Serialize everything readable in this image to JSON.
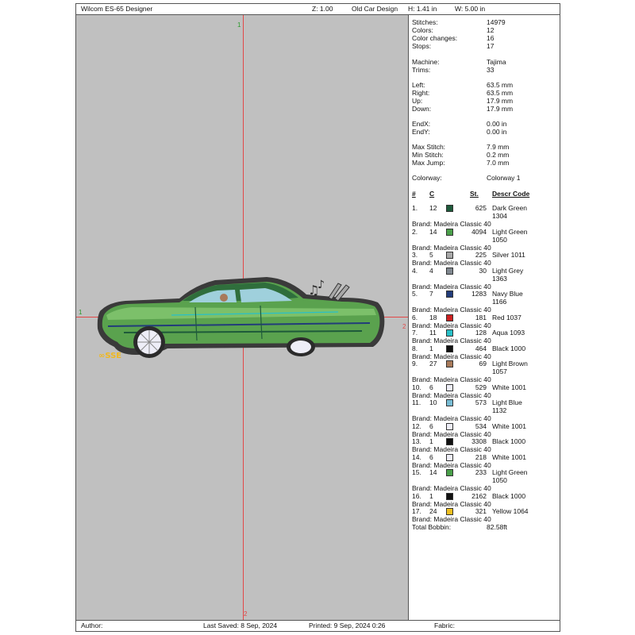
{
  "header": {
    "software": "Wilcom ES-65 Designer",
    "zoom": "Z: 1.00",
    "design_name": "Old Car Design",
    "height": "H: 1.41 in",
    "width": "W: 5.00 in"
  },
  "canvas": {
    "axis_top": "1",
    "axis_left": "1",
    "axis_right": "2",
    "axis_bottom": "2",
    "car_body_color": "#5aa24e",
    "outline_color": "#2b2b2b",
    "text_color": "#f0b820"
  },
  "stats": {
    "stitches_label": "Stitches:",
    "stitches": "14979",
    "colors_label": "Colors:",
    "colors": "12",
    "color_changes_label": "Color changes:",
    "color_changes": "16",
    "stops_label": "Stops:",
    "stops": "17",
    "machine_label": "Machine:",
    "machine": "Tajima",
    "trims_label": "Trims:",
    "trims": "33",
    "left_label": "Left:",
    "left": "63.5 mm",
    "right_label": "Right:",
    "right": "63.5 mm",
    "up_label": "Up:",
    "up": "17.9 mm",
    "down_label": "Down:",
    "down": "17.9 mm",
    "endx_label": "EndX:",
    "endx": "0.00 in",
    "endy_label": "EndY:",
    "endy": "0.00 in",
    "max_stitch_label": "Max Stitch:",
    "max_stitch": "7.9 mm",
    "min_stitch_label": "Min Stitch:",
    "min_stitch": "0.2 mm",
    "max_jump_label": "Max Jump:",
    "max_jump": "7.0 mm",
    "colorway_label": "Colorway:",
    "colorway": "Colorway 1"
  },
  "table_headers": {
    "num": "#",
    "c": "C",
    "st": "St.",
    "descr": "Descr Code"
  },
  "color_items": [
    {
      "num": "1.",
      "c": "12",
      "color": "#1e5a3a",
      "stitches": "625",
      "descr": "Dark Green",
      "code": "1304",
      "brand": "Brand: Madeira Classic 40"
    },
    {
      "num": "2.",
      "c": "14",
      "color": "#4aa04a",
      "stitches": "4094",
      "descr": "Light Green",
      "code": "1050",
      "brand": "Brand: Madeira Classic 40"
    },
    {
      "num": "3.",
      "c": "5",
      "color": "#a8a8a8",
      "stitches": "225",
      "descr": "Silver 1011",
      "code": "",
      "brand": "Brand: Madeira Classic 40"
    },
    {
      "num": "4.",
      "c": "4",
      "color": "#808890",
      "stitches": "30",
      "descr": "Light Grey",
      "code": "1363",
      "brand": "Brand: Madeira Classic 40"
    },
    {
      "num": "5.",
      "c": "7",
      "color": "#223c7a",
      "stitches": "1283",
      "descr": "Navy Blue",
      "code": "1166",
      "brand": "Brand: Madeira Classic 40"
    },
    {
      "num": "6.",
      "c": "18",
      "color": "#cc2020",
      "stitches": "181",
      "descr": "Red 1037",
      "code": "",
      "brand": "Brand: Madeira Classic 40"
    },
    {
      "num": "7.",
      "c": "11",
      "color": "#28c0c8",
      "stitches": "128",
      "descr": "Aqua 1093",
      "code": "",
      "brand": "Brand: Madeira Classic 40"
    },
    {
      "num": "8.",
      "c": "1",
      "color": "#111111",
      "stitches": "464",
      "descr": "Black 1000",
      "code": "",
      "brand": "Brand: Madeira Classic 40"
    },
    {
      "num": "9.",
      "c": "27",
      "color": "#a87a5a",
      "stitches": "69",
      "descr": "Light Brown",
      "code": "1057",
      "brand": "Brand: Madeira Classic 40"
    },
    {
      "num": "10.",
      "c": "6",
      "color": "#eeeef8",
      "stitches": "529",
      "descr": "White 1001",
      "code": "",
      "brand": "Brand: Madeira Classic 40"
    },
    {
      "num": "11.",
      "c": "10",
      "color": "#78bcd4",
      "stitches": "573",
      "descr": "Light Blue",
      "code": "1132",
      "brand": "Brand: Madeira Classic 40"
    },
    {
      "num": "12.",
      "c": "6",
      "color": "#eeeef8",
      "stitches": "534",
      "descr": "White 1001",
      "code": "",
      "brand": "Brand: Madeira Classic 40"
    },
    {
      "num": "13.",
      "c": "1",
      "color": "#111111",
      "stitches": "3308",
      "descr": "Black 1000",
      "code": "",
      "brand": "Brand: Madeira Classic 40"
    },
    {
      "num": "14.",
      "c": "6",
      "color": "#eeeef8",
      "stitches": "218",
      "descr": "White 1001",
      "code": "",
      "brand": "Brand: Madeira Classic 40"
    },
    {
      "num": "15.",
      "c": "14",
      "color": "#4aa04a",
      "stitches": "233",
      "descr": "Light Green",
      "code": "1050",
      "brand": "Brand: Madeira Classic 40"
    },
    {
      "num": "16.",
      "c": "1",
      "color": "#111111",
      "stitches": "2162",
      "descr": "Black 1000",
      "code": "",
      "brand": "Brand: Madeira Classic 40"
    },
    {
      "num": "17.",
      "c": "24",
      "color": "#f0c020",
      "stitches": "321",
      "descr": "Yellow 1064",
      "code": "",
      "brand": "Brand: Madeira Classic 40"
    }
  ],
  "total_bobbin_label": "Total Bobbin:",
  "total_bobbin": "82.58ft",
  "footer": {
    "author": "Author:",
    "last_saved": "Last Saved:  8 Sep, 2024",
    "printed": "Printed:  9 Sep, 2024  0:26",
    "fabric": "Fabric:"
  }
}
